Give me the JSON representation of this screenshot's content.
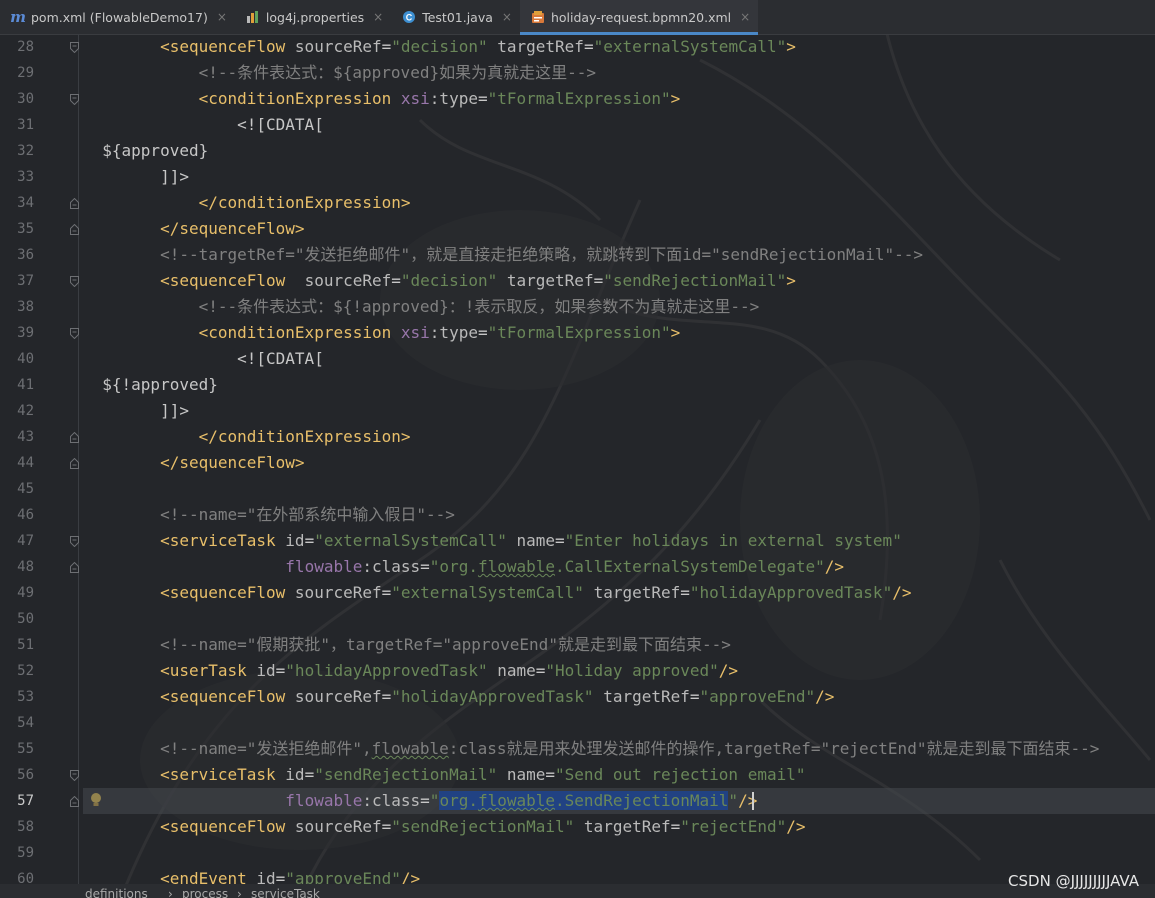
{
  "tabs": [
    {
      "label": "pom.xml (FlowableDemo17)",
      "icon": "maven-icon",
      "active": false
    },
    {
      "label": "log4j.properties",
      "icon": "properties-file-icon",
      "active": false
    },
    {
      "label": "Test01.java",
      "icon": "java-class-icon",
      "active": false
    },
    {
      "label": "holiday-request.bpmn20.xml",
      "icon": "xml-file-icon",
      "active": true
    }
  ],
  "tab_close_glyph": "×",
  "editor": {
    "current_line": "57",
    "line_numbers": [
      "28",
      "29",
      "30",
      "31",
      "32",
      "33",
      "34",
      "35",
      "36",
      "37",
      "38",
      "39",
      "40",
      "41",
      "42",
      "43",
      "44",
      "45",
      "46",
      "47",
      "48",
      "49",
      "50",
      "51",
      "52",
      "53",
      "54",
      "55",
      "56",
      "57",
      "58",
      "59",
      "60"
    ],
    "lines": [
      [
        [
          "p",
          "        "
        ],
        [
          "t",
          "<sequenceFlow "
        ],
        [
          "a",
          "sourceRef"
        ],
        [
          "p",
          "="
        ],
        [
          "v",
          "\"decision\" "
        ],
        [
          "a",
          "targetRef"
        ],
        [
          "p",
          "="
        ],
        [
          "v",
          "\"externalSystemCall\""
        ],
        [
          "t",
          ">"
        ]
      ],
      [
        [
          "p",
          "            "
        ],
        [
          "c",
          "<!--条件表达式：${approved}如果为真就走这里-->"
        ]
      ],
      [
        [
          "p",
          "            "
        ],
        [
          "t",
          "<conditionExpression "
        ],
        [
          "ns",
          "xsi"
        ],
        [
          "a",
          ":type"
        ],
        [
          "p",
          "="
        ],
        [
          "v",
          "\"tFormalExpression\""
        ],
        [
          "t",
          ">"
        ]
      ],
      [
        [
          "p",
          "                "
        ],
        [
          "p",
          "<![CDATA["
        ]
      ],
      [
        [
          "p",
          "  ${approved}"
        ]
      ],
      [
        [
          "p",
          "        ]]>"
        ]
      ],
      [
        [
          "p",
          "            "
        ],
        [
          "t",
          "</conditionExpression>"
        ]
      ],
      [
        [
          "p",
          "        "
        ],
        [
          "t",
          "</sequenceFlow>"
        ]
      ],
      [
        [
          "p",
          "        "
        ],
        [
          "c",
          "<!--targetRef=\"发送拒绝邮件\"，就是直接走拒绝策略，就跳转到下面id=\"sendRejectionMail\"-->"
        ]
      ],
      [
        [
          "p",
          "        "
        ],
        [
          "t",
          "<sequenceFlow  "
        ],
        [
          "a",
          "sourceRef"
        ],
        [
          "p",
          "="
        ],
        [
          "v",
          "\"decision\" "
        ],
        [
          "a",
          "targetRef"
        ],
        [
          "p",
          "="
        ],
        [
          "v",
          "\"sendRejectionMail\""
        ],
        [
          "t",
          ">"
        ]
      ],
      [
        [
          "p",
          "            "
        ],
        [
          "c",
          "<!--条件表达式：${!approved}：!表示取反，如果参数不为真就走这里-->"
        ]
      ],
      [
        [
          "p",
          "            "
        ],
        [
          "t",
          "<conditionExpression "
        ],
        [
          "ns",
          "xsi"
        ],
        [
          "a",
          ":type"
        ],
        [
          "p",
          "="
        ],
        [
          "v",
          "\"tFormalExpression\""
        ],
        [
          "t",
          ">"
        ]
      ],
      [
        [
          "p",
          "                "
        ],
        [
          "p",
          "<![CDATA["
        ]
      ],
      [
        [
          "p",
          "  ${!approved}"
        ]
      ],
      [
        [
          "p",
          "        ]]>"
        ]
      ],
      [
        [
          "p",
          "            "
        ],
        [
          "t",
          "</conditionExpression>"
        ]
      ],
      [
        [
          "p",
          "        "
        ],
        [
          "t",
          "</sequenceFlow>"
        ]
      ],
      [],
      [
        [
          "p",
          "        "
        ],
        [
          "c",
          "<!--name=\"在外部系统中输入假日\"-->"
        ]
      ],
      [
        [
          "p",
          "        "
        ],
        [
          "t",
          "<serviceTask "
        ],
        [
          "a",
          "id"
        ],
        [
          "p",
          "="
        ],
        [
          "v",
          "\"externalSystemCall\" "
        ],
        [
          "a",
          "name"
        ],
        [
          "p",
          "="
        ],
        [
          "v",
          "\"Enter holidays in external system\""
        ]
      ],
      [
        [
          "p",
          "                     "
        ],
        [
          "ns",
          "flowable"
        ],
        [
          "a",
          ":class"
        ],
        [
          "p",
          "="
        ],
        [
          "v",
          "\"org."
        ],
        [
          "vsq",
          "flowable"
        ],
        [
          "v",
          ".CallExternalSystemDelegate\""
        ],
        [
          "t",
          "/>"
        ]
      ],
      [
        [
          "p",
          "        "
        ],
        [
          "t",
          "<sequenceFlow "
        ],
        [
          "a",
          "sourceRef"
        ],
        [
          "p",
          "="
        ],
        [
          "v",
          "\"externalSystemCall\" "
        ],
        [
          "a",
          "targetRef"
        ],
        [
          "p",
          "="
        ],
        [
          "v",
          "\"holidayApprovedTask\""
        ],
        [
          "t",
          "/>"
        ]
      ],
      [],
      [
        [
          "p",
          "        "
        ],
        [
          "c",
          "<!--name=\"假期获批\"，targetRef=\"approveEnd\"就是走到最下面结束-->"
        ]
      ],
      [
        [
          "p",
          "        "
        ],
        [
          "t",
          "<userTask "
        ],
        [
          "a",
          "id"
        ],
        [
          "p",
          "="
        ],
        [
          "v",
          "\"holidayApprovedTask\" "
        ],
        [
          "a",
          "name"
        ],
        [
          "p",
          "="
        ],
        [
          "v",
          "\"Holiday approved\""
        ],
        [
          "t",
          "/>"
        ]
      ],
      [
        [
          "p",
          "        "
        ],
        [
          "t",
          "<sequenceFlow "
        ],
        [
          "a",
          "sourceRef"
        ],
        [
          "p",
          "="
        ],
        [
          "v",
          "\"holidayApprovedTask\" "
        ],
        [
          "a",
          "targetRef"
        ],
        [
          "p",
          "="
        ],
        [
          "v",
          "\"approveEnd\""
        ],
        [
          "t",
          "/>"
        ]
      ],
      [],
      [
        [
          "p",
          "        "
        ],
        [
          "c",
          "<!--name=\"发送拒绝邮件\","
        ],
        [
          "csq",
          "flowable"
        ],
        [
          "c",
          ":class就是用来处理发送邮件的操作,targetRef=\"rejectEnd\"就是走到最下面结束-->"
        ]
      ],
      [
        [
          "p",
          "        "
        ],
        [
          "t",
          "<serviceTask "
        ],
        [
          "a",
          "id"
        ],
        [
          "p",
          "="
        ],
        [
          "v",
          "\"sendRejectionMail\" "
        ],
        [
          "a",
          "name"
        ],
        [
          "p",
          "="
        ],
        [
          "v",
          "\"Send out rejection email\""
        ]
      ],
      [
        [
          "p",
          "                     "
        ],
        [
          "ns",
          "flowable"
        ],
        [
          "a",
          ":class"
        ],
        [
          "p",
          "="
        ],
        [
          "v",
          "\""
        ],
        [
          "vsel",
          "org."
        ],
        [
          "vselsq",
          "flowable"
        ],
        [
          "vsel",
          ".SendRejectionMail"
        ],
        [
          "v",
          "\""
        ],
        [
          "t",
          "/>"
        ]
      ],
      [
        [
          "p",
          "        "
        ],
        [
          "t",
          "<sequenceFlow "
        ],
        [
          "a",
          "sourceRef"
        ],
        [
          "p",
          "="
        ],
        [
          "v",
          "\"sendRejectionMail\" "
        ],
        [
          "a",
          "targetRef"
        ],
        [
          "p",
          "="
        ],
        [
          "v",
          "\"rejectEnd\""
        ],
        [
          "t",
          "/>"
        ]
      ],
      [],
      [
        [
          "p",
          "        "
        ],
        [
          "t",
          "<endEvent "
        ],
        [
          "a",
          "id"
        ],
        [
          "p",
          "="
        ],
        [
          "v",
          "\"approveEnd\""
        ],
        [
          "t",
          "/>"
        ]
      ]
    ]
  },
  "breadcrumb": {
    "items": [
      "definitions",
      "process",
      "serviceTask"
    ],
    "separator": "›"
  },
  "watermark": "CSDN @JJJJJJJJJAVA",
  "colors": {
    "tag": "#e8bf6a",
    "attr": "#bababa",
    "namespace": "#9876aa",
    "value": "#6a8759",
    "comment": "#808080",
    "selection": "#214283"
  }
}
